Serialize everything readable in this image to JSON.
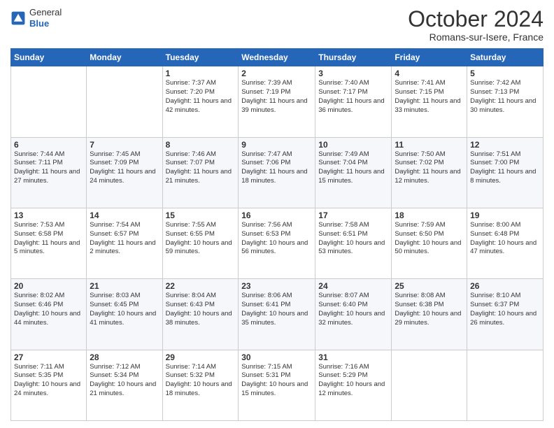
{
  "header": {
    "logo": {
      "line1": "General",
      "line2": "Blue"
    },
    "title": "October 2024",
    "subtitle": "Romans-sur-Isere, France"
  },
  "days_of_week": [
    "Sunday",
    "Monday",
    "Tuesday",
    "Wednesday",
    "Thursday",
    "Friday",
    "Saturday"
  ],
  "weeks": [
    [
      {
        "day": "",
        "info": ""
      },
      {
        "day": "",
        "info": ""
      },
      {
        "day": "1",
        "info": "Sunrise: 7:37 AM\nSunset: 7:20 PM\nDaylight: 11 hours\nand 42 minutes."
      },
      {
        "day": "2",
        "info": "Sunrise: 7:39 AM\nSunset: 7:19 PM\nDaylight: 11 hours\nand 39 minutes."
      },
      {
        "day": "3",
        "info": "Sunrise: 7:40 AM\nSunset: 7:17 PM\nDaylight: 11 hours\nand 36 minutes."
      },
      {
        "day": "4",
        "info": "Sunrise: 7:41 AM\nSunset: 7:15 PM\nDaylight: 11 hours\nand 33 minutes."
      },
      {
        "day": "5",
        "info": "Sunrise: 7:42 AM\nSunset: 7:13 PM\nDaylight: 11 hours\nand 30 minutes."
      }
    ],
    [
      {
        "day": "6",
        "info": "Sunrise: 7:44 AM\nSunset: 7:11 PM\nDaylight: 11 hours\nand 27 minutes."
      },
      {
        "day": "7",
        "info": "Sunrise: 7:45 AM\nSunset: 7:09 PM\nDaylight: 11 hours\nand 24 minutes."
      },
      {
        "day": "8",
        "info": "Sunrise: 7:46 AM\nSunset: 7:07 PM\nDaylight: 11 hours\nand 21 minutes."
      },
      {
        "day": "9",
        "info": "Sunrise: 7:47 AM\nSunset: 7:06 PM\nDaylight: 11 hours\nand 18 minutes."
      },
      {
        "day": "10",
        "info": "Sunrise: 7:49 AM\nSunset: 7:04 PM\nDaylight: 11 hours\nand 15 minutes."
      },
      {
        "day": "11",
        "info": "Sunrise: 7:50 AM\nSunset: 7:02 PM\nDaylight: 11 hours\nand 12 minutes."
      },
      {
        "day": "12",
        "info": "Sunrise: 7:51 AM\nSunset: 7:00 PM\nDaylight: 11 hours\nand 8 minutes."
      }
    ],
    [
      {
        "day": "13",
        "info": "Sunrise: 7:53 AM\nSunset: 6:58 PM\nDaylight: 11 hours\nand 5 minutes."
      },
      {
        "day": "14",
        "info": "Sunrise: 7:54 AM\nSunset: 6:57 PM\nDaylight: 11 hours\nand 2 minutes."
      },
      {
        "day": "15",
        "info": "Sunrise: 7:55 AM\nSunset: 6:55 PM\nDaylight: 10 hours\nand 59 minutes."
      },
      {
        "day": "16",
        "info": "Sunrise: 7:56 AM\nSunset: 6:53 PM\nDaylight: 10 hours\nand 56 minutes."
      },
      {
        "day": "17",
        "info": "Sunrise: 7:58 AM\nSunset: 6:51 PM\nDaylight: 10 hours\nand 53 minutes."
      },
      {
        "day": "18",
        "info": "Sunrise: 7:59 AM\nSunset: 6:50 PM\nDaylight: 10 hours\nand 50 minutes."
      },
      {
        "day": "19",
        "info": "Sunrise: 8:00 AM\nSunset: 6:48 PM\nDaylight: 10 hours\nand 47 minutes."
      }
    ],
    [
      {
        "day": "20",
        "info": "Sunrise: 8:02 AM\nSunset: 6:46 PM\nDaylight: 10 hours\nand 44 minutes."
      },
      {
        "day": "21",
        "info": "Sunrise: 8:03 AM\nSunset: 6:45 PM\nDaylight: 10 hours\nand 41 minutes."
      },
      {
        "day": "22",
        "info": "Sunrise: 8:04 AM\nSunset: 6:43 PM\nDaylight: 10 hours\nand 38 minutes."
      },
      {
        "day": "23",
        "info": "Sunrise: 8:06 AM\nSunset: 6:41 PM\nDaylight: 10 hours\nand 35 minutes."
      },
      {
        "day": "24",
        "info": "Sunrise: 8:07 AM\nSunset: 6:40 PM\nDaylight: 10 hours\nand 32 minutes."
      },
      {
        "day": "25",
        "info": "Sunrise: 8:08 AM\nSunset: 6:38 PM\nDaylight: 10 hours\nand 29 minutes."
      },
      {
        "day": "26",
        "info": "Sunrise: 8:10 AM\nSunset: 6:37 PM\nDaylight: 10 hours\nand 26 minutes."
      }
    ],
    [
      {
        "day": "27",
        "info": "Sunrise: 7:11 AM\nSunset: 5:35 PM\nDaylight: 10 hours\nand 24 minutes."
      },
      {
        "day": "28",
        "info": "Sunrise: 7:12 AM\nSunset: 5:34 PM\nDaylight: 10 hours\nand 21 minutes."
      },
      {
        "day": "29",
        "info": "Sunrise: 7:14 AM\nSunset: 5:32 PM\nDaylight: 10 hours\nand 18 minutes."
      },
      {
        "day": "30",
        "info": "Sunrise: 7:15 AM\nSunset: 5:31 PM\nDaylight: 10 hours\nand 15 minutes."
      },
      {
        "day": "31",
        "info": "Sunrise: 7:16 AM\nSunset: 5:29 PM\nDaylight: 10 hours\nand 12 minutes."
      },
      {
        "day": "",
        "info": ""
      },
      {
        "day": "",
        "info": ""
      }
    ]
  ]
}
